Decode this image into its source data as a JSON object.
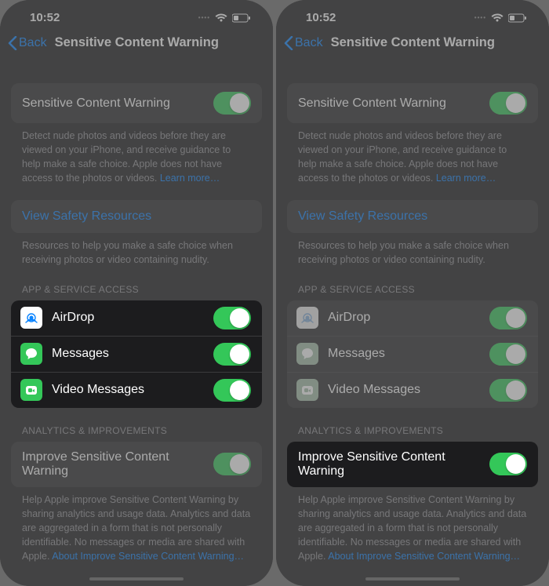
{
  "status": {
    "time": "10:52"
  },
  "nav": {
    "back": "Back",
    "title": "Sensitive Content Warning"
  },
  "section1": {
    "toggle_label": "Sensitive Content Warning",
    "footer": "Detect nude photos and videos before they are viewed on your iPhone, and receive guidance to help make a safe choice. Apple does not have access to the photos or videos.",
    "learn_more": "Learn more…"
  },
  "safety": {
    "link": "View Safety Resources",
    "footer": "Resources to help you make a safe choice when receiving photos or video containing nudity."
  },
  "apps": {
    "header": "APP & SERVICE ACCESS",
    "items": [
      {
        "label": "AirDrop"
      },
      {
        "label": "Messages"
      },
      {
        "label": "Video Messages"
      }
    ]
  },
  "analytics": {
    "header": "ANALYTICS & IMPROVEMENTS",
    "toggle_label": "Improve Sensitive Content Warning",
    "footer": "Help Apple improve Sensitive Content Warning by sharing analytics and usage data. Analytics and data are aggregated in a form that is not personally identifiable. No messages or media are shared with Apple.",
    "about": "About Improve Sensitive Content Warning…"
  }
}
